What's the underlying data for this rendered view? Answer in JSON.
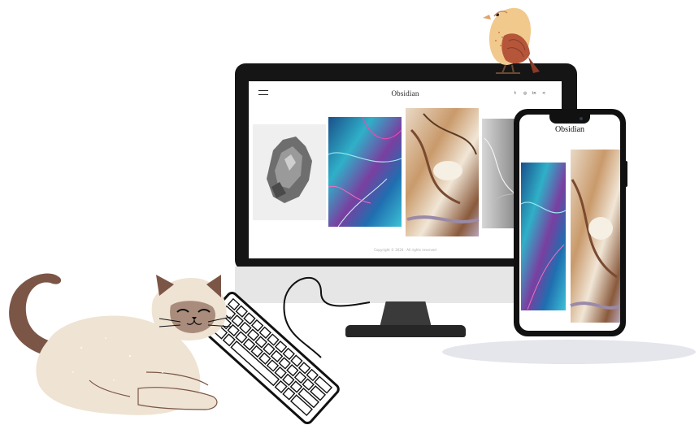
{
  "monitor": {
    "site_title": "Obsidian",
    "social_icons": [
      {
        "name": "twitter-icon",
        "glyph": "t"
      },
      {
        "name": "instagram-icon",
        "glyph": "◎"
      },
      {
        "name": "linkedin-icon",
        "glyph": "in"
      },
      {
        "name": "share-icon",
        "glyph": "<"
      }
    ],
    "footer_text": "Copyright © 2024 · All rights reserved"
  },
  "phone": {
    "site_title": "Obsidian"
  },
  "colors": {
    "bezel": "#151515",
    "chin": "#e6e6e6",
    "cat_body": "#efe3d3",
    "cat_points": "#7b5546",
    "bird_body": "#f2c98c",
    "bird_wing": "#b5563a"
  }
}
